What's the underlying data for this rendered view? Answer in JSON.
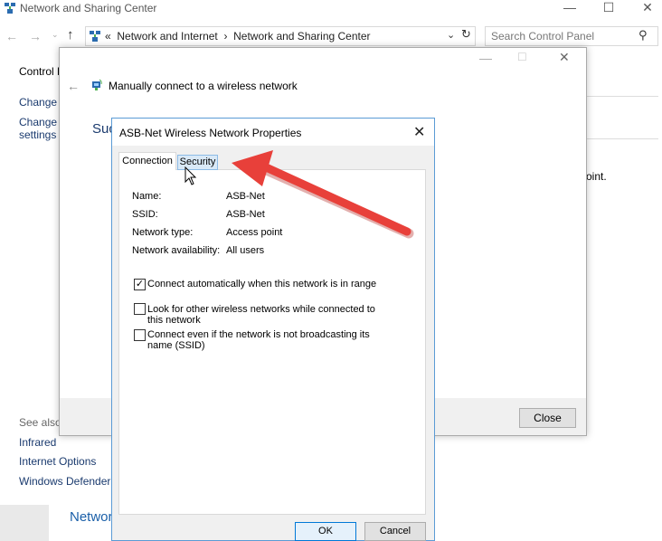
{
  "main_window": {
    "title": "Network and Sharing Center",
    "breadcrumb": {
      "chevron": "«",
      "parent": "Network and Internet",
      "separator": "›",
      "current": "Network and Sharing Center"
    },
    "search_placeholder": "Search Control Panel",
    "sidebar": {
      "top_items": [
        "Control P",
        "Change a",
        "Change a",
        "settings"
      ],
      "see_also_label": "See also",
      "see_also_items": [
        "Infrared",
        "Internet Options",
        "Windows Defender F"
      ]
    },
    "background_text_fragment": "oint.",
    "bottom_heading": "Networ"
  },
  "wizard": {
    "title": "Manually connect to a wireless network",
    "heading_fragment": "Suc",
    "close_button": "Close"
  },
  "properties_dialog": {
    "title": "ASB-Net Wireless Network Properties",
    "tabs": [
      {
        "label": "Connection",
        "active": true
      },
      {
        "label": "Security",
        "active": false,
        "hovered": true
      }
    ],
    "info": [
      {
        "label": "Name:",
        "value": "ASB-Net"
      },
      {
        "label": "SSID:",
        "value": "ASB-Net"
      },
      {
        "label": "Network type:",
        "value": "Access point"
      },
      {
        "label": "Network availability:",
        "value": "All users"
      }
    ],
    "options": [
      {
        "label": "Connect automatically when this network is in range",
        "checked": true
      },
      {
        "label": "Look for other wireless networks while connected to this network",
        "checked": false
      },
      {
        "label": "Connect even if the network is not broadcasting its name (SSID)",
        "checked": false
      }
    ],
    "ok_button": "OK",
    "cancel_button": "Cancel"
  },
  "annotation": {
    "color": "#e8403a",
    "points_to": "tab-security"
  }
}
